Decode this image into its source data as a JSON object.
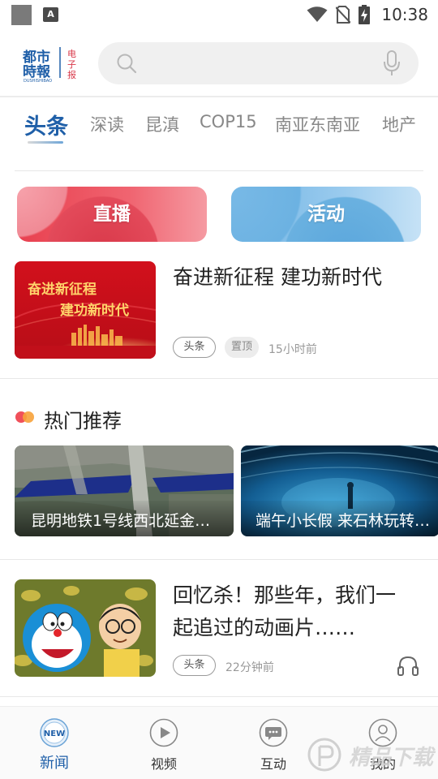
{
  "status_bar": {
    "time": "10:38",
    "notification_letter": "A"
  },
  "header": {
    "logo_text": [
      "都市",
      "時報"
    ],
    "logo_pinyin": "DUSHISHIBAO",
    "logo_side": "电子报",
    "search": {
      "placeholder": ""
    }
  },
  "tabs": [
    {
      "label": "头条",
      "active": true
    },
    {
      "label": "深读",
      "active": false
    },
    {
      "label": "昆滇",
      "active": false
    },
    {
      "label": "COP15",
      "active": false
    },
    {
      "label": "南亚东南亚",
      "active": false
    },
    {
      "label": "地产",
      "active": false
    }
  ],
  "quick_buttons": {
    "live": "直播",
    "activity": "活动"
  },
  "news": [
    {
      "title": "奋进新征程  建功新时代",
      "thumb_line1": "奋进新征程",
      "thumb_line2": "建功新时代",
      "tag": "头条",
      "pinned": "置顶",
      "time": "15小时前"
    },
    {
      "title": "回忆杀！那些年，我们一起追过的动画片……",
      "tag": "头条",
      "time": "22分钟前"
    }
  ],
  "hot": {
    "title": "热门推荐",
    "items": [
      {
        "caption": "昆明地铁1号线西北延金…"
      },
      {
        "caption": "端午小长假 来石林玩转…"
      }
    ]
  },
  "bottom_nav": [
    {
      "label": "新闻",
      "icon": "news-icon",
      "badge": "NEW",
      "active": true
    },
    {
      "label": "视频",
      "icon": "video-play-icon",
      "active": false
    },
    {
      "label": "互动",
      "icon": "chat-icon",
      "active": false
    },
    {
      "label": "我的",
      "icon": "profile-icon",
      "active": false
    }
  ],
  "watermark": "精品下载",
  "colors": {
    "accent": "#1f5fa8",
    "live_red": "#e8404f",
    "activity_blue": "#6fb4e4"
  }
}
